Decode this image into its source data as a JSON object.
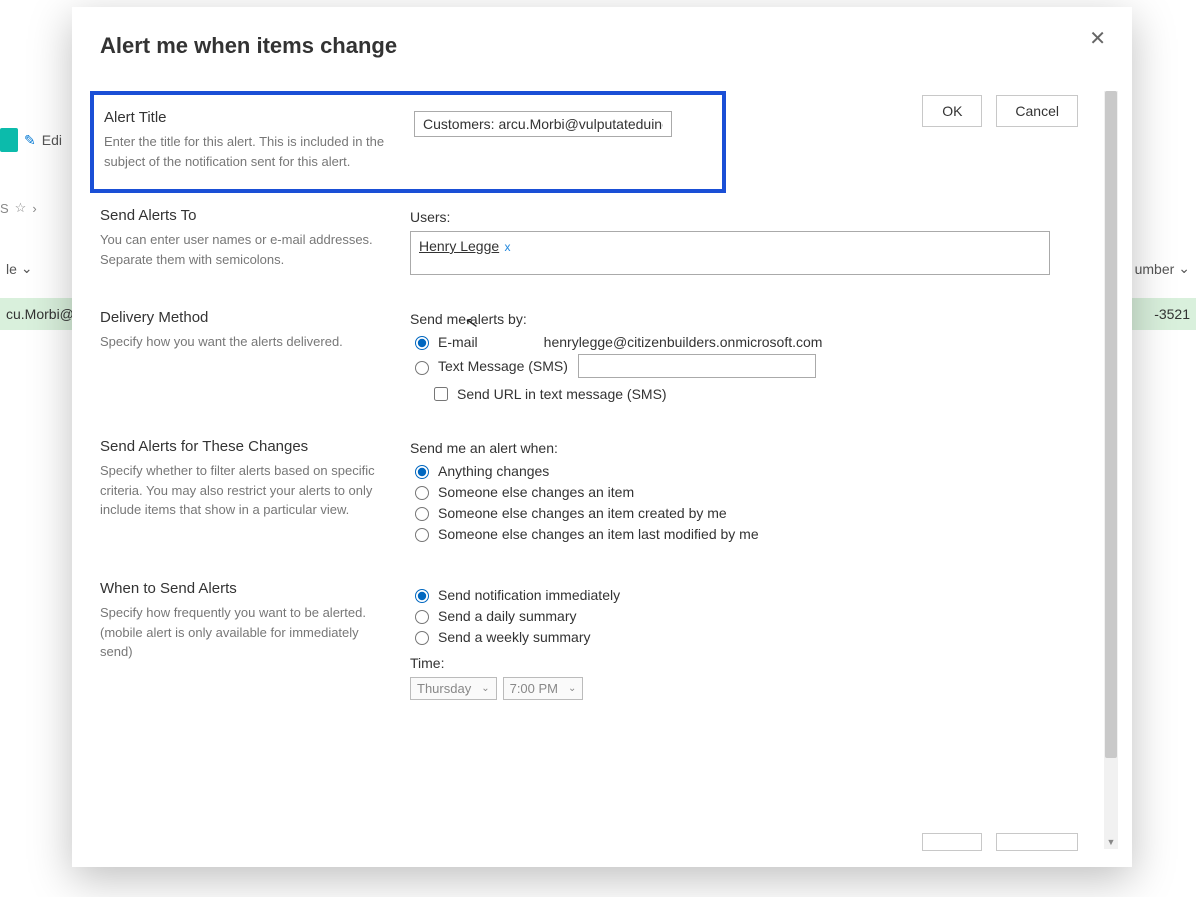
{
  "background": {
    "edit_label": "Edi",
    "star_row": "S",
    "col_left": "le",
    "col_right": "umber",
    "sel_left": "cu.Morbi@",
    "sel_right": "-3521"
  },
  "modal": {
    "title": "Alert me when items change",
    "ok": "OK",
    "cancel": "Cancel",
    "sections": {
      "alert_title": {
        "heading": "Alert Title",
        "desc": "Enter the title for this alert. This is included in the subject of the notification sent for this alert.",
        "value": "Customers: arcu.Morbi@vulputateduinec."
      },
      "send_to": {
        "heading": "Send Alerts To",
        "desc": "You can enter user names or e-mail addresses. Separate them with semicolons.",
        "field_label": "Users:",
        "person": "Henry Legge"
      },
      "delivery": {
        "heading": "Delivery Method",
        "desc": "Specify how you want the alerts delivered.",
        "field_label": "Send me alerts by:",
        "email_label": "E-mail",
        "email_value": "henrylegge@citizenbuilders.onmicrosoft.com",
        "sms_label": "Text Message (SMS)",
        "sms_url_label": "Send URL in text message (SMS)"
      },
      "changes": {
        "heading": "Send Alerts for These Changes",
        "desc": "Specify whether to filter alerts based on specific criteria. You may also restrict your alerts to only include items that show in a particular view.",
        "field_label": "Send me an alert when:",
        "opt1": "Anything changes",
        "opt2": "Someone else changes an item",
        "opt3": "Someone else changes an item created by me",
        "opt4": "Someone else changes an item last modified by me"
      },
      "when": {
        "heading": "When to Send Alerts",
        "desc": "Specify how frequently you want to be alerted. (mobile alert is only available for immediately send)",
        "opt1": "Send notification immediately",
        "opt2": "Send a daily summary",
        "opt3": "Send a weekly summary",
        "time_label": "Time:",
        "day": "Thursday",
        "hour": "7:00 PM"
      }
    }
  }
}
